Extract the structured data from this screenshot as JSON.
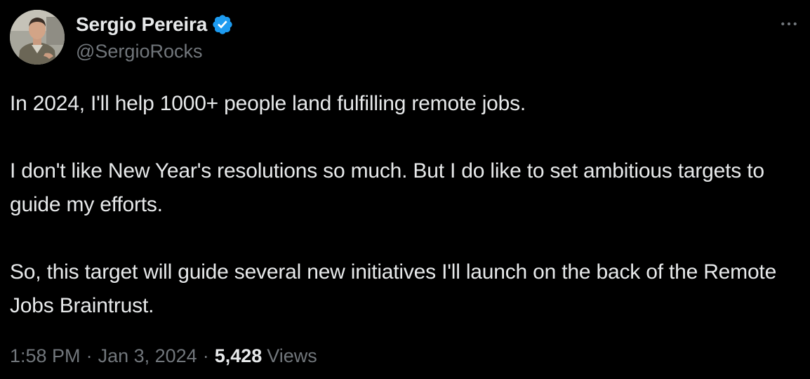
{
  "author": {
    "display_name": "Sergio Pereira",
    "handle": "@SergioRocks",
    "verified": true,
    "verified_badge_color": "#1d9bf0"
  },
  "menu": {
    "icon": "more-horizontal-icon"
  },
  "tweet": {
    "paragraphs": [
      "In 2024, I'll help 1000+ people land fulfilling remote jobs.",
      "I don't like New Year's resolutions so much. But I do like to set ambitious targets to guide my efforts.",
      "So, this target will guide several new initiatives I'll launch on the back of the Remote Jobs Braintrust."
    ]
  },
  "meta": {
    "time": "1:58 PM",
    "separator": "·",
    "date": "Jan 3, 2024",
    "views_count": "5,428",
    "views_label": "Views"
  },
  "colors": {
    "background": "#000000",
    "primary_text": "#e7e9ea",
    "secondary_text": "#71767b"
  }
}
